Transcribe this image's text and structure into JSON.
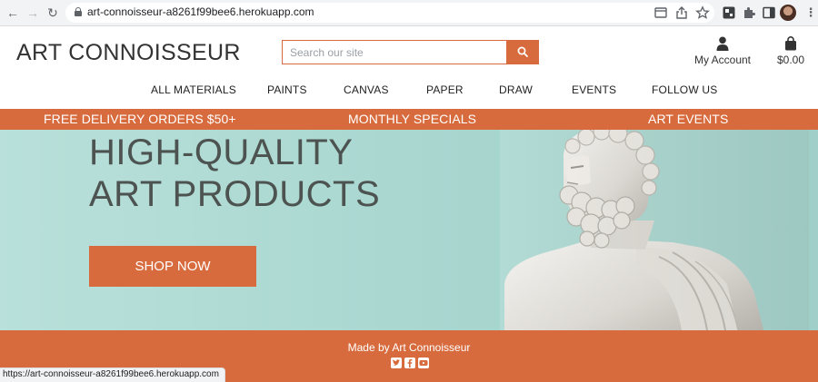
{
  "browser": {
    "url_host": "art-connoisseur-a8261f99bee6.herokuapp.com",
    "icons": [
      "back-icon",
      "forward-icon",
      "reload-icon",
      "lock-icon",
      "cast-icon",
      "share-icon",
      "bookmark-star-icon",
      "extension-icon",
      "puzzle-icon",
      "sidebar-icon",
      "profile-avatar",
      "menu-dots-icon"
    ]
  },
  "header": {
    "logo": "ART CONNOISSEUR",
    "search_placeholder": "Search our site",
    "account_label": "My Account",
    "cart_total": "$0.00"
  },
  "nav": {
    "items": [
      "ALL MATERIALS",
      "PAINTS",
      "CANVAS",
      "PAPER",
      "DRAW",
      "EVENTS",
      "FOLLOW US"
    ]
  },
  "promo": {
    "items": [
      "FREE DELIVERY ORDERS $50+",
      "MONTHLY SPECIALS",
      "ART EVENTS"
    ]
  },
  "hero": {
    "title_line1": "HIGH-QUALITY",
    "title_line2": "ART PRODUCTS",
    "cta": "SHOP NOW"
  },
  "footer": {
    "made_by": "Made by Art Connoisseur",
    "socials": [
      "twitter-icon",
      "facebook-icon",
      "youtube-icon"
    ]
  },
  "status_bar": {
    "link": "https://art-connoisseur-a8261f99bee6.herokuapp.com"
  },
  "colors": {
    "accent": "#d86b3d",
    "hero_bg": "#acd9d2",
    "hero_text": "#4d5350"
  }
}
